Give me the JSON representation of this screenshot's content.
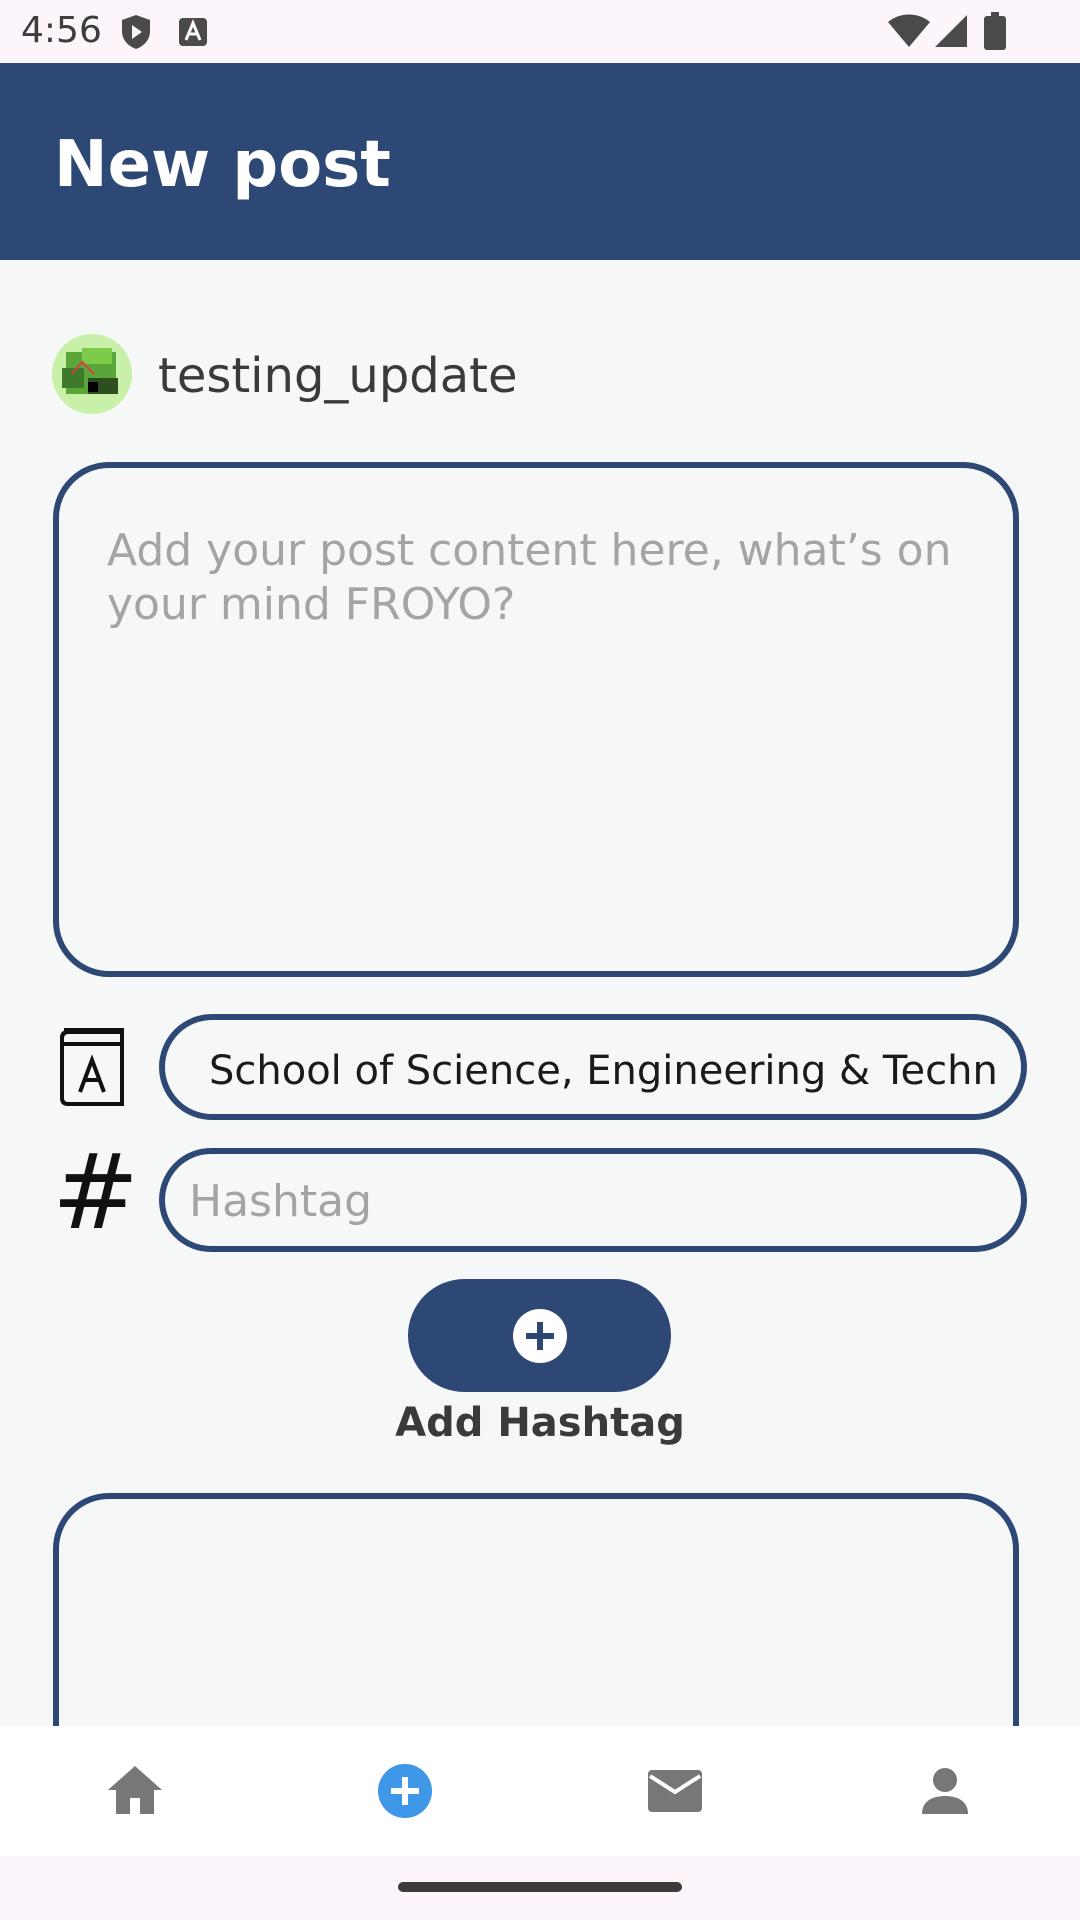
{
  "status_bar": {
    "time": "4:56",
    "icons": [
      "shield-play-icon",
      "font-a-icon",
      "wifi-icon",
      "signal-icon",
      "battery-icon"
    ]
  },
  "app_bar": {
    "title": "New post"
  },
  "user": {
    "username": "testing_update"
  },
  "post": {
    "content_placeholder": "Add your post content here, what’s on your mind FROYO?",
    "content_value": ""
  },
  "school": {
    "value": "School of Science, Engineering & Techno.."
  },
  "hashtag": {
    "placeholder": "Hashtag",
    "value": ""
  },
  "add_hashtag": {
    "label": "Add Hashtag"
  },
  "bottom_nav": {
    "items": [
      {
        "icon": "home-icon",
        "active": false
      },
      {
        "icon": "add-circle-icon",
        "active": true
      },
      {
        "icon": "mail-icon",
        "active": false
      },
      {
        "icon": "person-icon",
        "active": false
      }
    ]
  },
  "colors": {
    "primary": "#2e4876",
    "active_nav": "#3f97e8",
    "inactive_nav": "#777777",
    "placeholder": "#a4a4a4"
  }
}
